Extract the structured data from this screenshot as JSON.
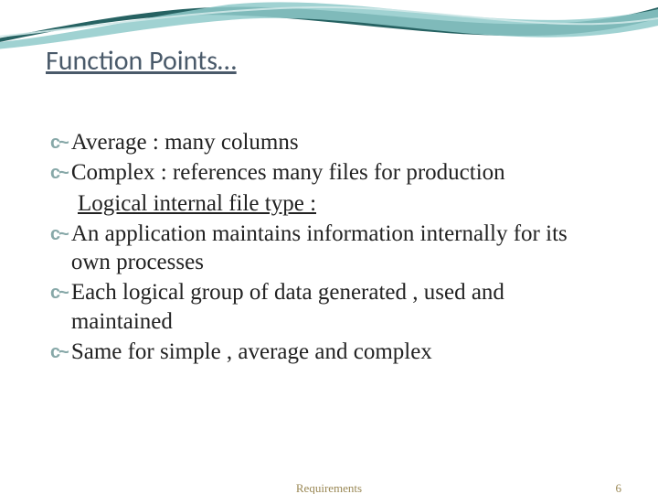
{
  "title": "Function Points…",
  "bullets": [
    {
      "text": "Average : many columns",
      "cont": []
    },
    {
      "text": "Complex : references many files for production",
      "cont": [
        "Logical internal file type :"
      ],
      "contUnderline": true
    },
    {
      "text": "An application maintains information internally for its own processes",
      "cont": []
    },
    {
      "text": "Each logical group of data generated , used and maintained",
      "cont": []
    },
    {
      "text": "Same for simple , average and complex",
      "cont": []
    }
  ],
  "footer": {
    "center": "Requirements",
    "right": "6"
  }
}
